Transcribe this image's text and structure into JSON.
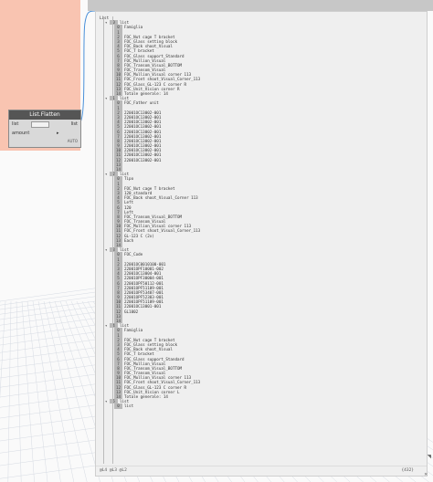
{
  "node": {
    "title": "List.Flatten",
    "input_port": "list",
    "input2_port": "amount",
    "output_port": "list",
    "lacing": "AUTO"
  },
  "preview": {
    "root": "List",
    "lines": [
      {
        "t": "list",
        "k": "h",
        "d": 0,
        "i": "0"
      },
      {
        "t": "Famiglia",
        "k": "i",
        "i": "0"
      },
      {
        "t": "",
        "k": "i",
        "i": "1"
      },
      {
        "t": "FOC_Nut cage T bracket",
        "k": "i",
        "i": "2"
      },
      {
        "t": "FOC_Glass setting block",
        "k": "i",
        "i": "3"
      },
      {
        "t": "FOC_Back shoot_Visual",
        "k": "i",
        "i": "4"
      },
      {
        "t": "FOC_T bracket",
        "k": "i",
        "i": "5"
      },
      {
        "t": "FOC_Glass support_Standard",
        "k": "i",
        "i": "6"
      },
      {
        "t": "FOC_Mullion_Visual",
        "k": "i",
        "i": "7"
      },
      {
        "t": "FOC_Transom_Visual_BOTTOM",
        "k": "i",
        "i": "8"
      },
      {
        "t": "FOC_Transom_Visual",
        "k": "i",
        "i": "9"
      },
      {
        "t": "FOC_Mullion_Visual corner 113",
        "k": "i",
        "i": "10"
      },
      {
        "t": "FOC_Front shoot_Visual_Corner_113",
        "k": "i",
        "i": "11"
      },
      {
        "t": "FOC_Glass_GL-123 C corner R",
        "k": "i",
        "i": "12"
      },
      {
        "t": "FOC_Unit_Vision corner R",
        "k": "i",
        "i": "13"
      },
      {
        "t": "Totale generale: 14",
        "k": "i",
        "i": "14"
      },
      {
        "t": "list",
        "k": "h",
        "d": 0,
        "i": "1"
      },
      {
        "t": "FOC_Father unit",
        "k": "i",
        "i": "0"
      },
      {
        "t": "",
        "k": "i",
        "i": "1"
      },
      {
        "t": "22001OC13002-001",
        "k": "i",
        "i": "2"
      },
      {
        "t": "22001OC13002-001",
        "k": "i",
        "i": "3"
      },
      {
        "t": "22001OC13002-001",
        "k": "i",
        "i": "4"
      },
      {
        "t": "22001OC13002-001",
        "k": "i",
        "i": "5"
      },
      {
        "t": "22001OC13002-001",
        "k": "i",
        "i": "6"
      },
      {
        "t": "22001OC13002-001",
        "k": "i",
        "i": "7"
      },
      {
        "t": "22001OC13002-001",
        "k": "i",
        "i": "8"
      },
      {
        "t": "22001OC13002-001",
        "k": "i",
        "i": "9"
      },
      {
        "t": "22001OC13002-001",
        "k": "i",
        "i": "10"
      },
      {
        "t": "22001OC13002-001",
        "k": "i",
        "i": "11"
      },
      {
        "t": "22001OC13002-001",
        "k": "i",
        "i": "12"
      },
      {
        "t": "",
        "k": "i",
        "i": "13"
      },
      {
        "t": "",
        "k": "i",
        "i": "14"
      },
      {
        "t": "list",
        "k": "h",
        "d": 0,
        "i": "2"
      },
      {
        "t": "Tipo",
        "k": "i",
        "i": "0"
      },
      {
        "t": "",
        "k": "i",
        "i": "1"
      },
      {
        "t": "FOC_Nut cage T bracket",
        "k": "i",
        "i": "2"
      },
      {
        "t": "120_standard",
        "k": "i",
        "i": "3"
      },
      {
        "t": "FOC_Back shoot_Visual_Corner 113",
        "k": "i",
        "i": "4"
      },
      {
        "t": "Left",
        "k": "i",
        "i": "5"
      },
      {
        "t": "120",
        "k": "i",
        "i": "6"
      },
      {
        "t": "Left",
        "k": "i",
        "i": "7"
      },
      {
        "t": "FOC_Transom_Visual_BOTTOM",
        "k": "i",
        "i": "8"
      },
      {
        "t": "FOC_Transom_Visual",
        "k": "i",
        "i": "9"
      },
      {
        "t": "FOC_Mullion_Visual corner 113",
        "k": "i",
        "i": "10"
      },
      {
        "t": "FOC_Front shoot_Visual_Corner_113",
        "k": "i",
        "i": "11"
      },
      {
        "t": "GL-123 C (2x)",
        "k": "i",
        "i": "12"
      },
      {
        "t": "Each",
        "k": "i",
        "i": "13"
      },
      {
        "t": "",
        "k": "i",
        "i": "14"
      },
      {
        "t": "list",
        "k": "h",
        "d": 0,
        "i": "3"
      },
      {
        "t": "FOC_Code",
        "k": "i",
        "i": "0"
      },
      {
        "t": "",
        "k": "i",
        "i": "1"
      },
      {
        "t": "22001OC0010100-001",
        "k": "i",
        "i": "2"
      },
      {
        "t": "22001OPF10001-002",
        "k": "i",
        "i": "3"
      },
      {
        "t": "22001OC13004-001",
        "k": "i",
        "i": "4"
      },
      {
        "t": "22001OPF30004-001",
        "k": "i",
        "i": "5"
      },
      {
        "t": "22001OPF50112-001",
        "k": "i",
        "i": "6"
      },
      {
        "t": "22001OPF51109-001",
        "k": "i",
        "i": "7"
      },
      {
        "t": "22001OPF53407-001",
        "k": "i",
        "i": "8"
      },
      {
        "t": "22001OPF52303-001",
        "k": "i",
        "i": "9"
      },
      {
        "t": "22001OPF51109-001",
        "k": "i",
        "i": "10"
      },
      {
        "t": "22001OC13001-001",
        "k": "i",
        "i": "11"
      },
      {
        "t": "GL1002",
        "k": "i",
        "i": "12"
      },
      {
        "t": "",
        "k": "i",
        "i": "13"
      },
      {
        "t": "",
        "k": "i",
        "i": "14"
      },
      {
        "t": "list",
        "k": "h",
        "d": 0,
        "i": "4"
      },
      {
        "t": "Famiglia",
        "k": "i",
        "i": "0"
      },
      {
        "t": "",
        "k": "i",
        "i": "1"
      },
      {
        "t": "FOC_Nut cage T bracket",
        "k": "i",
        "i": "2"
      },
      {
        "t": "FOC_Glass setting block",
        "k": "i",
        "i": "3"
      },
      {
        "t": "FOC_Back shoot_Visual",
        "k": "i",
        "i": "4"
      },
      {
        "t": "FOC_T bracket",
        "k": "i",
        "i": "5"
      },
      {
        "t": "FOC_Glass support_Standard",
        "k": "i",
        "i": "6"
      },
      {
        "t": "FOC_Mullion_Visual",
        "k": "i",
        "i": "7"
      },
      {
        "t": "FOC_Transom_Visual_BOTTOM",
        "k": "i",
        "i": "8"
      },
      {
        "t": "FOC_Transom_Visual",
        "k": "i",
        "i": "9"
      },
      {
        "t": "FOC_Mullion_Visual corner 113",
        "k": "i",
        "i": "10"
      },
      {
        "t": "FOC_Front shoot_Visual_Corner_113",
        "k": "i",
        "i": "11"
      },
      {
        "t": "FOC_Glass_GL-123 C corner R",
        "k": "i",
        "i": "12"
      },
      {
        "t": "FOC_Unit_Vision corner L",
        "k": "i",
        "i": "13"
      },
      {
        "t": "Totale generale: 14",
        "k": "i",
        "i": "14"
      },
      {
        "t": "list",
        "k": "h",
        "d": 0,
        "i": "5"
      },
      {
        "t": "list",
        "k": "i",
        "i": "0"
      }
    ],
    "footer_left": "@L4 @L3 @L2",
    "footer_right": "{432}"
  }
}
